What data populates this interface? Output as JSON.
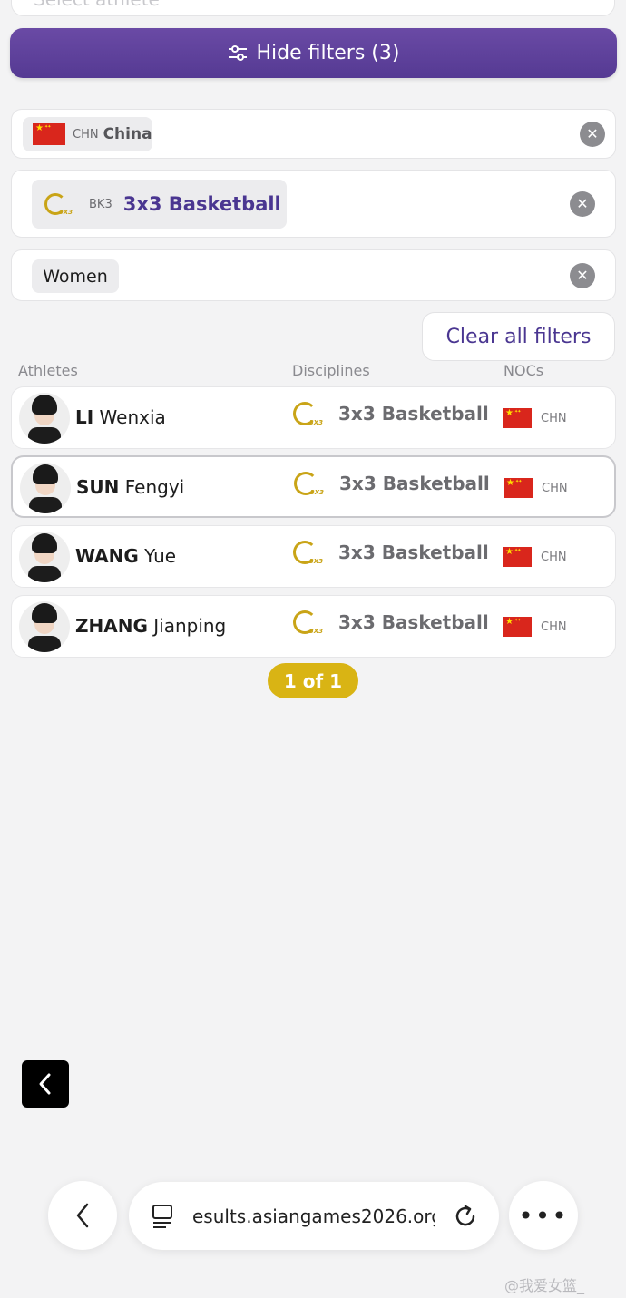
{
  "search": {
    "placeholder": "Select athlete"
  },
  "filters": {
    "hide_label": "Hide filters (3)",
    "noc": {
      "code": "CHN",
      "label": "China"
    },
    "discipline": {
      "code": "BK3",
      "label": "3x3 Basketball"
    },
    "gender": {
      "label": "Women"
    },
    "clear_all": "Clear all filters"
  },
  "table": {
    "headers": {
      "athletes": "Athletes",
      "disciplines": "Disciplines",
      "nocs": "NOCs"
    },
    "rows": [
      {
        "surname": "LI",
        "given": "Wenxia",
        "discipline": "3x3 Basketball",
        "noc": "CHN"
      },
      {
        "surname": "SUN",
        "given": "Fengyi",
        "discipline": "3x3 Basketball",
        "noc": "CHN"
      },
      {
        "surname": "WANG",
        "given": "Yue",
        "discipline": "3x3 Basketball",
        "noc": "CHN"
      },
      {
        "surname": "ZHANG",
        "given": "Jianping",
        "discipline": "3x3 Basketball",
        "noc": "CHN"
      }
    ]
  },
  "pagination": {
    "label": "1 of 1"
  },
  "browser": {
    "url": "esults.asiangames2026.org"
  },
  "watermark": "@我爱女篮_",
  "colors": {
    "primary": "#5b3f99",
    "accent": "#d9b414",
    "flag_red": "#d9261c"
  },
  "icons": [
    "sliders-icon",
    "close-icon",
    "chevron-left-icon",
    "reader-mode-icon",
    "reload-icon",
    "more-icon"
  ]
}
